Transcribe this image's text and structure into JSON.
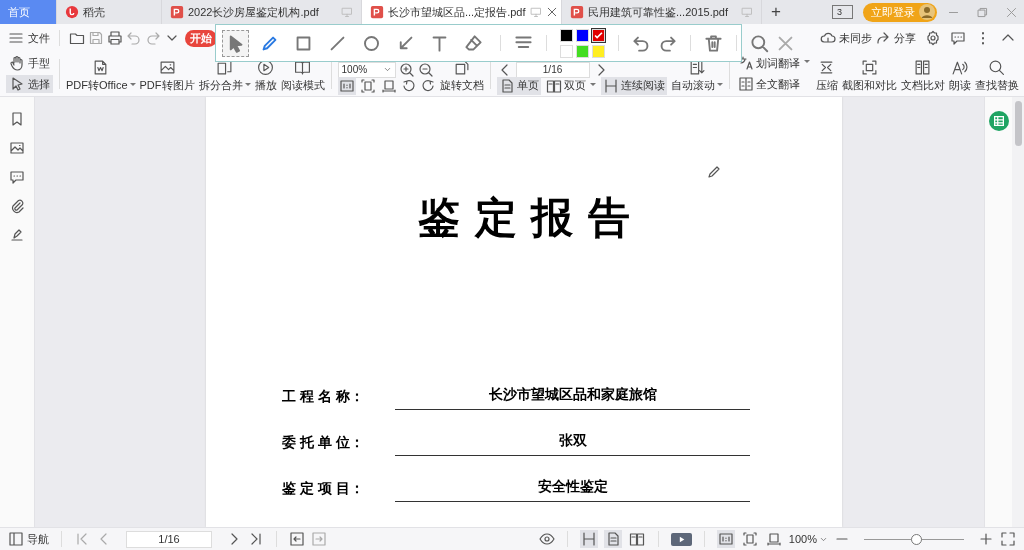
{
  "tabs": [
    {
      "label": "首页",
      "kind": "home",
      "selected": false,
      "closable": false
    },
    {
      "label": "稻壳",
      "kind": "docer",
      "selected": false,
      "closable": false
    },
    {
      "label": "2022长沙房屋鉴定机构.pdf",
      "kind": "pdf",
      "selected": false,
      "closable": false
    },
    {
      "label": "长沙市望城区品...定报告.pdf",
      "kind": "pdf",
      "selected": true,
      "closable": true
    },
    {
      "label": "民用建筑可靠性鉴...2015.pdf",
      "kind": "pdf",
      "selected": false,
      "closable": false
    }
  ],
  "new_tab": "+",
  "window_count": "3",
  "login_button": "立即登录",
  "file_menu": "文件",
  "start_tab": "开始",
  "sync_status": "未同步",
  "share_button": "分享",
  "cursor_modes": [
    {
      "label": "手型",
      "selected": false
    },
    {
      "label": "选择",
      "selected": true
    }
  ],
  "ribbon_a": [
    {
      "label": "PDF转Office",
      "dropdown": true
    },
    {
      "label": "PDF转图片",
      "dropdown": false
    },
    {
      "label": "拆分合并",
      "dropdown": true
    },
    {
      "label": "播放",
      "dropdown": false
    },
    {
      "label": "阅读模式",
      "dropdown": false
    }
  ],
  "zoom_field": "100%",
  "fit_modes": [
    {
      "selected": true
    },
    {
      "selected": false
    },
    {
      "selected": false
    }
  ],
  "rotate_button": "旋转文档",
  "page_field": "1/16",
  "view_modes": [
    {
      "label": "单页",
      "selected": true,
      "dropdown": false
    },
    {
      "label": "双页",
      "selected": false,
      "dropdown": true
    },
    {
      "label": "连续阅读",
      "selected": true,
      "dropdown": false
    }
  ],
  "auto_scroll": {
    "label": "自动滚动",
    "dropdown": true
  },
  "translate": [
    {
      "label": "划词翻译",
      "dropdown": true
    },
    {
      "label": "全文翻译",
      "dropdown": false
    }
  ],
  "ribbon_b": [
    {
      "label": "压缩"
    },
    {
      "label": "截图和对比"
    },
    {
      "label": "文档比对"
    },
    {
      "label": "朗读"
    },
    {
      "label": "查找替换"
    }
  ],
  "annotation_toolbar": {
    "tools": [
      {
        "selected": true
      },
      {
        "selected": false
      },
      {
        "selected": false
      },
      {
        "selected": false
      },
      {
        "selected": false
      },
      {
        "selected": false
      },
      {
        "selected": false
      },
      {
        "selected": false
      }
    ],
    "colors": [
      {
        "color": "#000000",
        "selected": false
      },
      {
        "color": "#0000ff",
        "selected": false
      },
      {
        "color": "#e00000",
        "selected": true
      },
      {
        "color": "#ffffff",
        "selected": false
      },
      {
        "color": "#44dd22",
        "selected": false
      },
      {
        "color": "#ffee22",
        "selected": false
      }
    ]
  },
  "document": {
    "title": "鉴 定 报 告",
    "fields": [
      {
        "label": "工 程 名 称：",
        "value": "长沙市望城区品和家庭旅馆"
      },
      {
        "label": "委 托 单 位：",
        "value": "张双"
      },
      {
        "label": "鉴 定 项 目：",
        "value": "安全性鉴定"
      }
    ]
  },
  "status_bar": {
    "nav": "导航",
    "page_field": "1/16",
    "view_modes": [
      {
        "selected": true
      },
      {
        "selected": true
      },
      {
        "selected": false
      }
    ],
    "fit_modes": [
      {
        "selected": true
      },
      {
        "selected": false
      },
      {
        "selected": false
      }
    ],
    "zoom": "100%",
    "level": 0.52
  }
}
